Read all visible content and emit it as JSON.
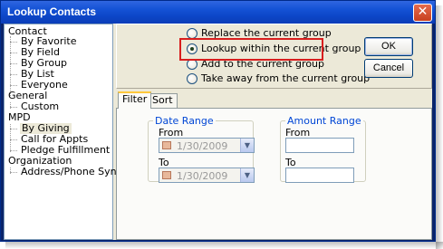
{
  "window": {
    "title": "Lookup Contacts",
    "close_label": "✕"
  },
  "tree": {
    "groups": [
      {
        "label": "Contact",
        "items": [
          "By Favorite",
          "By Field",
          "By Group",
          "By List",
          "Everyone"
        ]
      },
      {
        "label": "General",
        "items": [
          "Custom"
        ]
      },
      {
        "label": "MPD",
        "items": [
          "By Giving",
          "Call for Appts",
          "Pledge Fulfillment"
        ]
      },
      {
        "label": "Organization",
        "items": [
          "Address/Phone Sync"
        ]
      }
    ],
    "selected": "By Giving"
  },
  "options": {
    "replace": "Replace the current group",
    "lookup_within": "Lookup within the current group",
    "add_to": "Add to the current group",
    "take_away": "Take away from the current group",
    "selected": "lookup_within"
  },
  "buttons": {
    "ok": "OK",
    "cancel": "Cancel"
  },
  "tabs": {
    "filter": "Filter",
    "sort": "Sort",
    "active": "filter"
  },
  "filter": {
    "date_range": {
      "title": "Date Range",
      "from_label": "From",
      "from_value": "1/30/2009",
      "to_label": "To",
      "to_value": "1/30/2009"
    },
    "amount_range": {
      "title": "Amount Range",
      "from_label": "From",
      "from_value": "",
      "to_label": "To",
      "to_value": ""
    }
  },
  "colors": {
    "titlebar": "#0c45c6",
    "highlight": "#d81e1e",
    "group_title": "#0046d5"
  }
}
